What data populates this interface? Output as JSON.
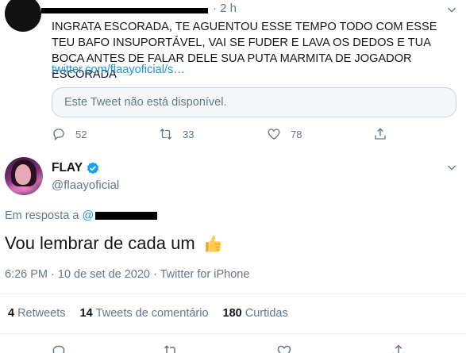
{
  "previous_tweet": {
    "time": "· 2 h",
    "text": "INGRATA ESCORADA, TE AGUENTOU ESSE TEMPO TODO COM ESSE TEU BAFO INSUPORTÁVEL, VAI SE FUDER E LAVA OS DEDOS E TUA BOCA ANTES DE FALAR DELE SUA PUTA MARMITA DE JOGADOR ESCORADA",
    "link": "twitter.com/flaayoficial/s…",
    "quote_unavailable": "Este Tweet não está disponível.",
    "actions": {
      "reply_count": "52",
      "retweet_count": "33",
      "like_count": "78"
    }
  },
  "main_tweet": {
    "name": "FLAY",
    "handle": "@flaayoficial",
    "reply_prefix": "Em resposta a",
    "reply_at": "@",
    "text": "Vou lembrar de cada um",
    "meta": "6:26 PM · 10 de set de 2020 · Twitter for iPhone",
    "stats": {
      "retweets_count": "4",
      "retweets_label": "Retweets",
      "comments_count": "14",
      "comments_label": "Tweets de comentário",
      "likes_count": "180",
      "likes_label": "Curtidas"
    }
  },
  "colors": {
    "link": "#1b95e0",
    "muted": "#657786",
    "text": "#14171a",
    "border": "#e6ecf0"
  },
  "icons": [
    "reply-icon",
    "retweet-icon",
    "like-icon",
    "share-icon",
    "verified-icon",
    "chevron-down-icon",
    "thumbs-up-icon"
  ]
}
